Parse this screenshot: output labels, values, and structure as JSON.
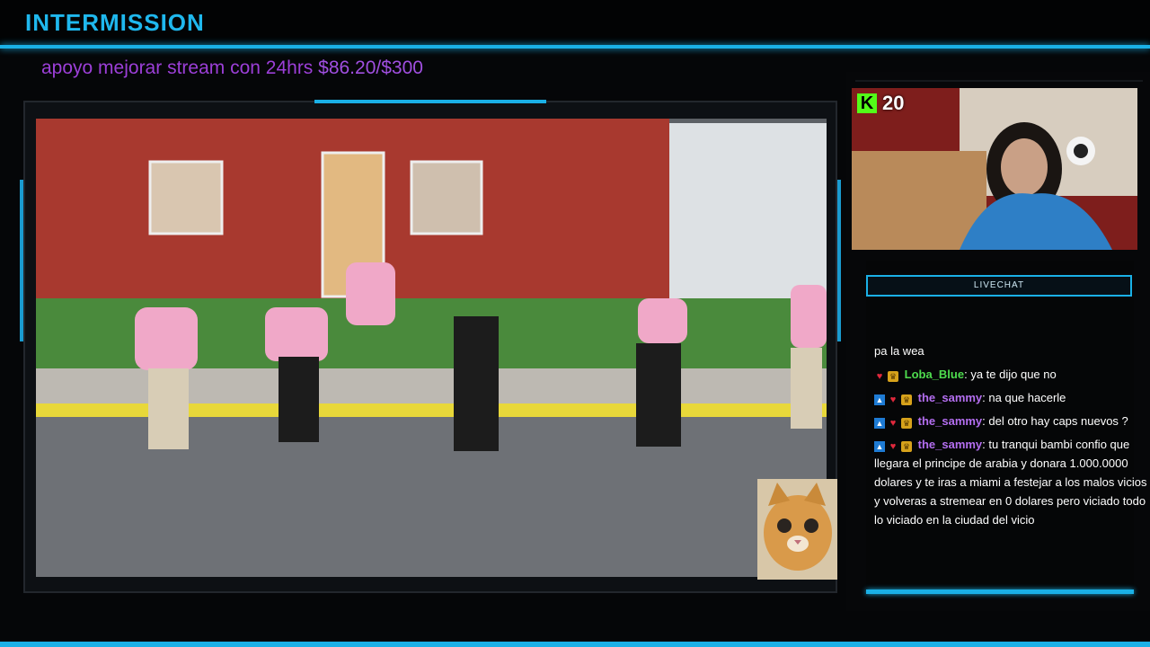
{
  "header": {
    "title": "INTERMISSION"
  },
  "goal": {
    "text": "apoyo mejorar stream con 24hrs ",
    "amount": "$86.20/$300"
  },
  "webcam": {
    "sub_count": "20",
    "kick_label": "K"
  },
  "chat": {
    "header": "LIVECHAT",
    "messages": [
      {
        "type": "continuation",
        "text": "pa la wea"
      },
      {
        "badges": [
          "heart-icon",
          "crown-icon"
        ],
        "user": "Loba_Blue",
        "user_color": "#4edc4e",
        "text": ": ya te dijo que no"
      },
      {
        "badges": [
          "kick-icon",
          "heart-icon",
          "crown-icon"
        ],
        "user": "the_sammy",
        "user_color": "#b46ef0",
        "text": ": na que hacerle"
      },
      {
        "badges": [
          "kick-icon",
          "heart-icon",
          "crown-icon"
        ],
        "user": "the_sammy",
        "user_color": "#b46ef0",
        "text": ": del otro hay caps nuevos ?"
      },
      {
        "badges": [
          "kick-icon",
          "heart-icon",
          "crown-icon"
        ],
        "user": "the_sammy",
        "user_color": "#b46ef0",
        "text": ": tu tranqui bambi confio que llegara el principe de arabia y donara 1.000.0000 dolares y te iras a miami a festejar a los malos vicios y volveras a stremear en 0 dolares pero viciado todo lo viciado en la ciudad del vicio"
      }
    ]
  },
  "colors": {
    "accent": "#1ab0e6",
    "goal": "#9c3fd8",
    "kick": "#53fc18"
  }
}
